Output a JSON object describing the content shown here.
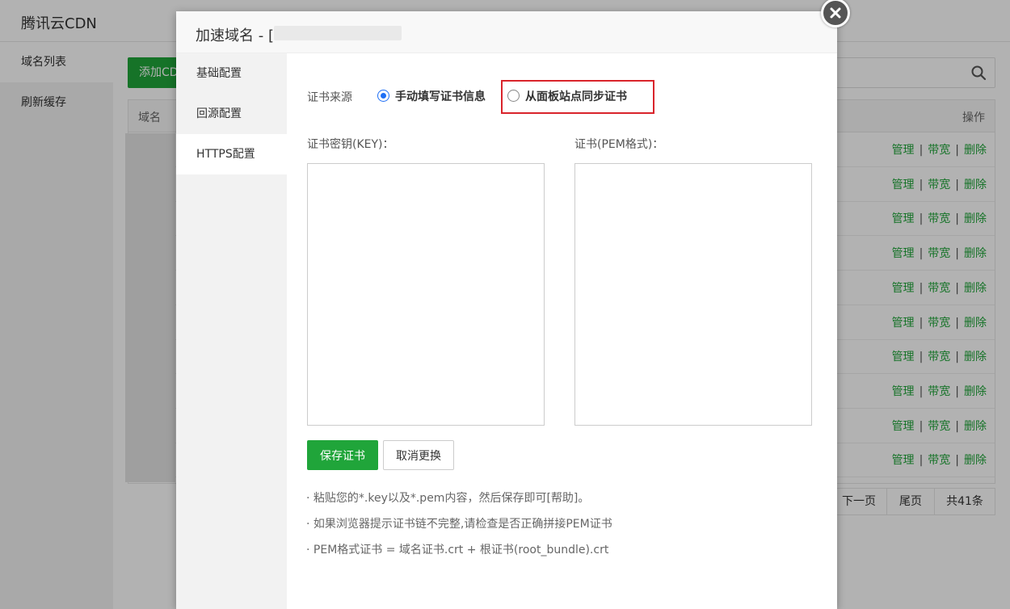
{
  "app": {
    "title": "腾讯云CDN",
    "sidebar": [
      "域名列表",
      "刷新缓存"
    ],
    "add_button_label": "添加CD",
    "table": {
      "headers": {
        "domain": "域名",
        "operations": "操作"
      },
      "row_actions": [
        "管理",
        "带宽",
        "删除"
      ],
      "action_separator": "|",
      "row_count": 10
    },
    "pagination": {
      "next": "下一页",
      "last": "尾页",
      "total": "共41条"
    }
  },
  "modal": {
    "title": "加速域名 - [",
    "nav": [
      "基础配置",
      "回源配置",
      "HTTPS配置"
    ],
    "active_nav": "HTTPS配置",
    "cert_source": {
      "label": "证书来源",
      "options": [
        {
          "label": "手动填写证书信息",
          "checked": true
        },
        {
          "label": "从面板站点同步证书",
          "checked": false
        }
      ]
    },
    "key_field": {
      "label": "证书密钥(KEY)：",
      "value": ""
    },
    "pem_field": {
      "label": "证书(PEM格式)：",
      "value": ""
    },
    "buttons": {
      "save": "保存证书",
      "cancel": "取消更换"
    },
    "tips": [
      "· 粘贴您的*.key以及*.pem内容，然后保存即可",
      "[帮助]",
      "。",
      "· 如果浏览器提示证书链不完整,请检查是否正确拼接PEM证书",
      "· PEM格式证书 = 域名证书.crt + 根证书(root_bundle).crt"
    ]
  },
  "colors": {
    "primary_green": "#20a53a",
    "radio_blue": "#1e6ff5",
    "highlight_red": "#d9242b"
  }
}
